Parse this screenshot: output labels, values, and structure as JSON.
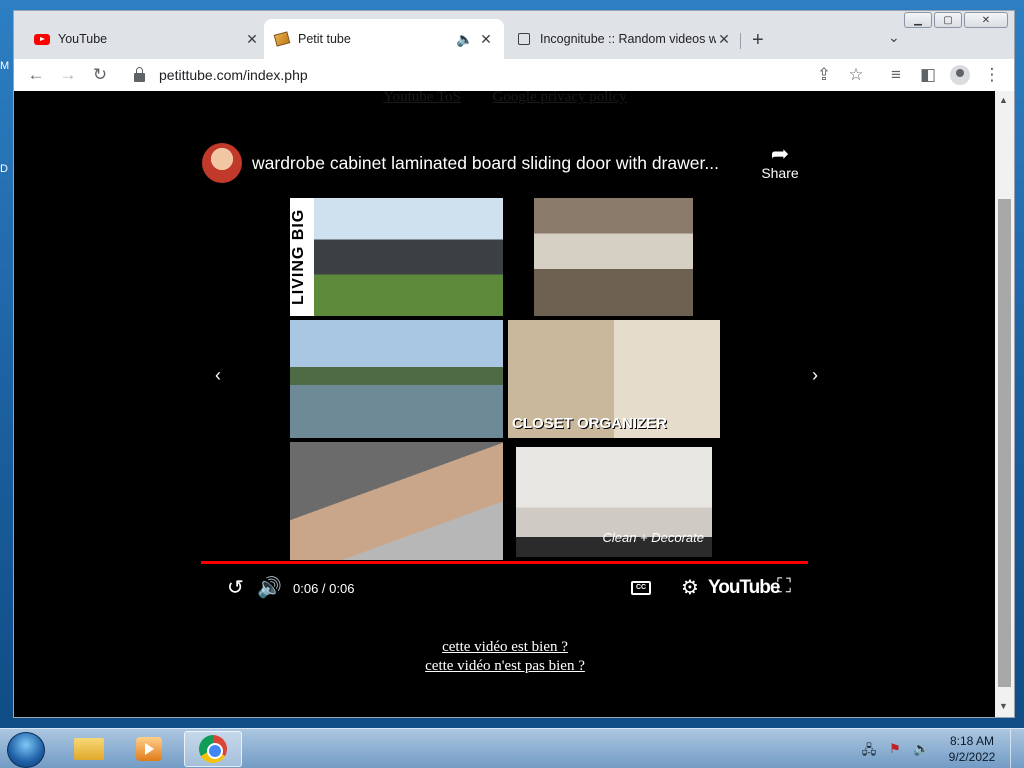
{
  "desktop": {
    "edge_top": "M",
    "edge_mid": "D"
  },
  "browser": {
    "tabs": [
      {
        "label": "YouTube",
        "icon": "youtube-icon",
        "active": false
      },
      {
        "label": "Petit tube",
        "icon": "petittube-icon",
        "active": true
      },
      {
        "label": "Incognitube :: Random videos wi",
        "icon": "incognitube-icon",
        "active": false
      }
    ],
    "url": "petittube.com/index.php"
  },
  "page": {
    "top_links": [
      "Youtube ToS",
      "Google privacy policy"
    ],
    "video": {
      "title": "wardrobe cabinet laminated board sliding door with drawer...",
      "share_label": "Share",
      "time": "0:06 / 0:06",
      "cc_label": "CC",
      "youtube_label": "YouTube",
      "thumbnails": [
        {
          "overlay": "LIVING BIG"
        },
        {
          "overlay": ""
        },
        {
          "overlay": ""
        },
        {
          "overlay": "CLOSET ORGANIZER"
        },
        {
          "overlay": ""
        },
        {
          "overlay": "Clean + Decorate"
        }
      ]
    },
    "feedback": {
      "good": "cette vidéo est bien ?",
      "bad": "cette vidéo n'est pas bien ?"
    }
  },
  "taskbar": {
    "time": "8:18 AM",
    "date": "9/2/2022"
  }
}
